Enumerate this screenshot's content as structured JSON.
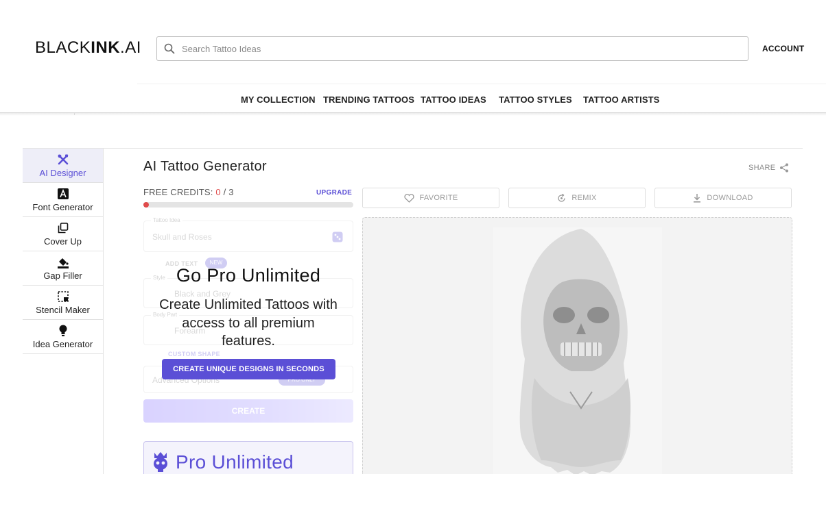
{
  "header": {
    "logo_light": "BLACK",
    "logo_bold": "INK",
    "logo_suffix": ".AI",
    "search_placeholder": "Search Tattoo Ideas",
    "account_label": "ACCOUNT"
  },
  "nav": {
    "items": [
      "MY COLLECTION",
      "TRENDING TATTOOS",
      "TATTOO IDEAS",
      "TATTOO STYLES",
      "TATTOO ARTISTS"
    ]
  },
  "sidebar": {
    "items": [
      {
        "label": "AI Designer",
        "icon": "tools-icon",
        "active": true
      },
      {
        "label": "Font Generator",
        "icon": "font-icon"
      },
      {
        "label": "Cover Up",
        "icon": "cover-up-icon"
      },
      {
        "label": "Gap Filler",
        "icon": "paint-bucket-icon"
      },
      {
        "label": "Stencil Maker",
        "icon": "stencil-icon"
      },
      {
        "label": "Idea Generator",
        "icon": "lightbulb-icon"
      }
    ]
  },
  "main": {
    "title": "AI Tattoo Generator",
    "share_label": "SHARE",
    "credits_label": "FREE CREDITS: ",
    "credits_used": "0",
    "credits_sep": " / ",
    "credits_total": "3",
    "credits_progress": 0.0,
    "upgrade_label": "UPGRADE",
    "actions": {
      "favorite": "FAVORITE",
      "remix": "REMIX",
      "download": "DOWNLOAD"
    }
  },
  "form": {
    "idea_caption": "Tattoo Idea",
    "idea_value": "Skull and Roses",
    "add_text_label": "ADD TEXT",
    "new_badge": "NEW",
    "style_caption": "Style",
    "style_value": "Black and Grey",
    "body_caption": "Body Part",
    "body_value": "Forearm",
    "custom_shape_label": "CUSTOM SHAPE",
    "advanced_label": "Advanced Options",
    "pro_only_label": "PRO ONLY",
    "create_label": "CREATE"
  },
  "promo": {
    "title": "Go Pro Unlimited",
    "text": "Create Unlimited Tattoos with access to all premium features.",
    "button": "CREATE UNIQUE DESIGNS IN SECONDS",
    "plan_name": "Pro Unlimited"
  },
  "colors": {
    "accent": "#5b4fd6",
    "credit_used": "#e04b4b",
    "active_bg": "#eeeef8"
  }
}
